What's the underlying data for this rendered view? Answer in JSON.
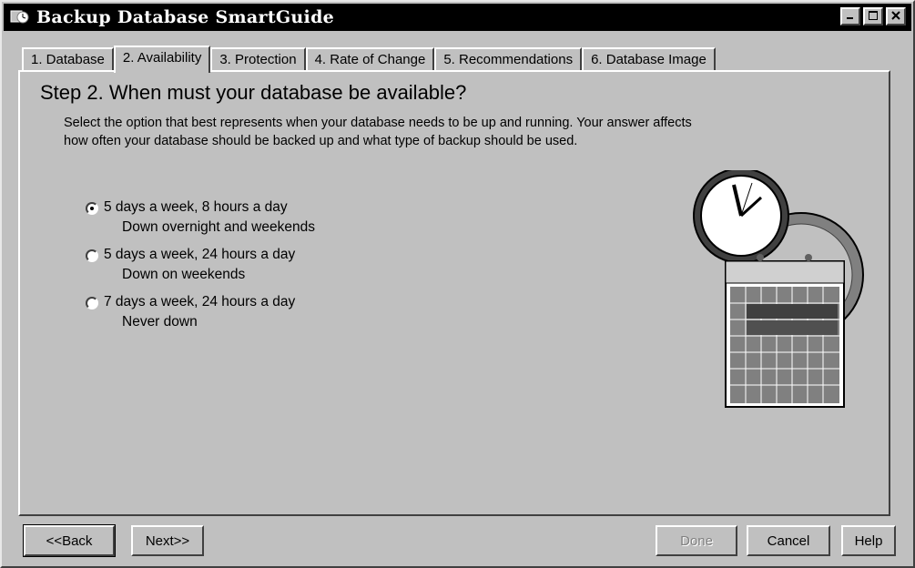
{
  "window": {
    "title": "Backup Database SmartGuide"
  },
  "tabs": [
    {
      "label": "1. Database"
    },
    {
      "label": "2. Availability",
      "active": true
    },
    {
      "label": "3. Protection"
    },
    {
      "label": "4. Rate of Change"
    },
    {
      "label": "5. Recommendations"
    },
    {
      "label": "6. Database Image"
    }
  ],
  "step": {
    "title": "Step 2. When must your database be available?",
    "description": "Select the option that best represents when your database needs to be up and running. Your answer affects how often your database should be backed up and what type of backup should be used."
  },
  "options": [
    {
      "label": "5 days a week, 8 hours a day",
      "sub": "Down overnight and weekends",
      "selected": true
    },
    {
      "label": "5 days a week, 24 hours a day",
      "sub": "Down on weekends",
      "selected": false
    },
    {
      "label": "7 days a week, 24 hours a day",
      "sub": "Never down",
      "selected": false
    }
  ],
  "illustration": {
    "icon": "clock-calendar-icon"
  },
  "buttons": {
    "back": "<<Back",
    "next": "Next>>",
    "done": "Done",
    "cancel": "Cancel",
    "help": "Help"
  },
  "colors": {
    "titlebar": "#000000",
    "face": "#c0c0c0"
  }
}
